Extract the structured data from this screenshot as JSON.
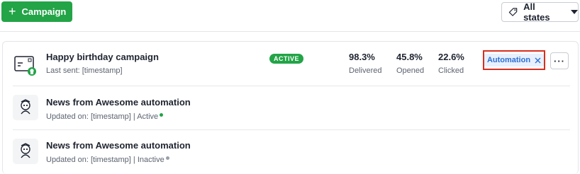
{
  "toolbar": {
    "new_campaign_label": "Campaign",
    "filter_label": "All states"
  },
  "campaigns": [
    {
      "title": "Happy birthday campaign",
      "meta": "Last sent: [timestamp]",
      "status_badge": "ACTIVE",
      "stats": [
        {
          "value": "98.3%",
          "label": "Delivered"
        },
        {
          "value": "45.8%",
          "label": "Opened"
        },
        {
          "value": "22.6%",
          "label": "Clicked"
        }
      ],
      "tag": "Automation",
      "more_label": "···"
    },
    {
      "title": "News from Awesome automation",
      "meta_prefix": "Updated on: [timestamp] | ",
      "state": "Active",
      "state_color": "#22a447"
    },
    {
      "title": "News from Awesome automation",
      "meta_prefix": "Updated on: [timestamp] | ",
      "state": "Inactive",
      "state_color": "#9aa0a8"
    }
  ],
  "colors": {
    "primary_green": "#22a447",
    "highlight_red": "#d72e1f",
    "tag_blue": "#2b6fd6"
  },
  "icons": [
    "plus-icon",
    "tag-icon",
    "chevron-down-icon",
    "close-icon",
    "email-campaign-icon",
    "robot-icon",
    "more-icon"
  ]
}
